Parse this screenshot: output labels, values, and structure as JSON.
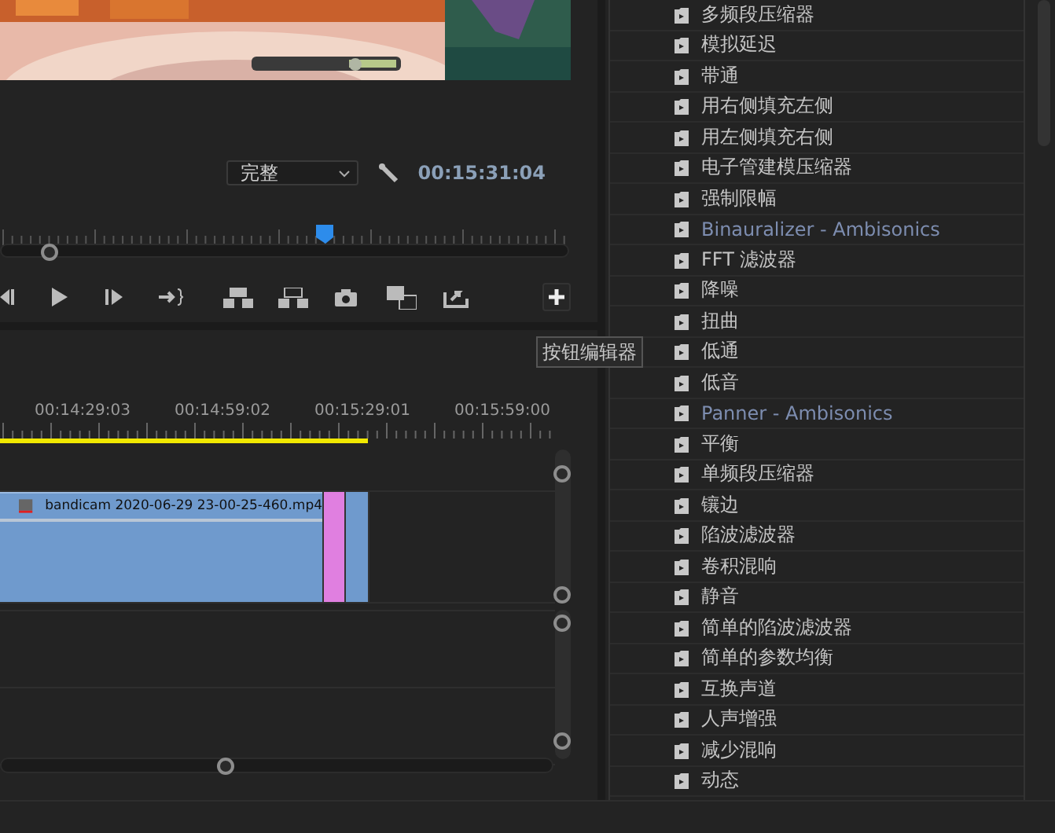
{
  "program_monitor": {
    "zoom_select": "完整",
    "timecode": "00:15:31:04",
    "tooltip": "按钮编辑器"
  },
  "timeline": {
    "time_labels": [
      "00:14:29:03",
      "00:14:59:02",
      "00:15:29:01",
      "00:15:59:00"
    ],
    "clip": {
      "name": "bandicam 2020-06-29 23-00-25-460.mp4"
    }
  },
  "effects": [
    {
      "label": "多频段压缩器",
      "kind": "effect"
    },
    {
      "label": "模拟延迟",
      "kind": "effect"
    },
    {
      "label": "带通",
      "kind": "effect"
    },
    {
      "label": "用右侧填充左侧",
      "kind": "effect"
    },
    {
      "label": "用左侧填充右侧",
      "kind": "effect"
    },
    {
      "label": "电子管建模压缩器",
      "kind": "effect"
    },
    {
      "label": "强制限幅",
      "kind": "effect"
    },
    {
      "label": "Binauralizer - Ambisonics",
      "kind": "ambisonics"
    },
    {
      "label": "FFT 滤波器",
      "kind": "effect"
    },
    {
      "label": "降噪",
      "kind": "effect"
    },
    {
      "label": "扭曲",
      "kind": "effect"
    },
    {
      "label": "低通",
      "kind": "effect"
    },
    {
      "label": "低音",
      "kind": "effect"
    },
    {
      "label": "Panner - Ambisonics",
      "kind": "ambisonics"
    },
    {
      "label": "平衡",
      "kind": "effect"
    },
    {
      "label": "单频段压缩器",
      "kind": "effect"
    },
    {
      "label": "镶边",
      "kind": "effect"
    },
    {
      "label": "陷波滤波器",
      "kind": "effect"
    },
    {
      "label": "卷积混响",
      "kind": "effect"
    },
    {
      "label": "静音",
      "kind": "effect"
    },
    {
      "label": "简单的陷波滤波器",
      "kind": "effect"
    },
    {
      "label": "简单的参数均衡",
      "kind": "effect"
    },
    {
      "label": "互换声道",
      "kind": "effect"
    },
    {
      "label": "人声增强",
      "kind": "effect"
    },
    {
      "label": "减少混响",
      "kind": "effect"
    },
    {
      "label": "动态",
      "kind": "effect"
    }
  ]
}
